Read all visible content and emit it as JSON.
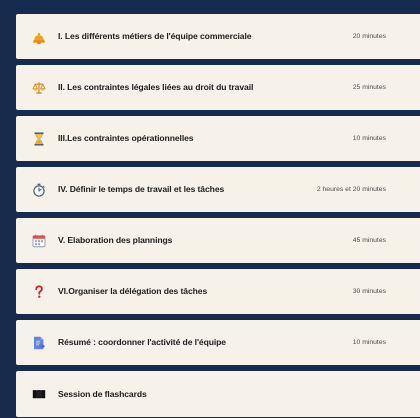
{
  "items": [
    {
      "icon": "bell-icon",
      "title": "I. Les différents métiers de l'équipe commerciale",
      "duration": "20 minutes"
    },
    {
      "icon": "scales-icon",
      "title": "II. Les contraintes légales liées au droit du travail",
      "duration": "25 minutes"
    },
    {
      "icon": "hourglass-icon",
      "title": "III.Les contraintes opérationnelles",
      "duration": "10 minutes"
    },
    {
      "icon": "stopwatch-icon",
      "title": "IV. Définir le temps de travail et les tâches",
      "duration": "2 heures et 20 minutes"
    },
    {
      "icon": "calendar-icon",
      "title": "V. Elaboration des plannings",
      "duration": "45 minutes"
    },
    {
      "icon": "question-icon",
      "title": "VI.Organiser la délégation des tâches",
      "duration": "30 minutes"
    },
    {
      "icon": "document-arrow-icon",
      "title": "Résumé : coordonner l'activité de l'équipe",
      "duration": "10 minutes"
    },
    {
      "icon": "flashcards-icon",
      "title": "Session de flashcards",
      "duration": ""
    }
  ],
  "colors": {
    "background": "#172b4f",
    "item_background": "#f6f2e9",
    "text": "#202020",
    "duration_text": "#4d4d4d"
  }
}
